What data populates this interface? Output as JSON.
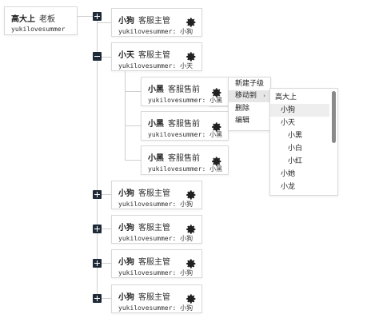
{
  "root": {
    "name": "高大上",
    "role": "老板",
    "account": "yukilovesummer"
  },
  "nodes": [
    {
      "name": "小狗",
      "role": "客服主管",
      "account": "yukilovesummer",
      "owner": "小狗"
    },
    {
      "name": "小天",
      "role": "客服主管",
      "account": "yukilovesummer",
      "owner": "小天"
    },
    {
      "name": "小黑",
      "role": "客服售前",
      "account": "yukilovesummer",
      "owner": "小黑"
    },
    {
      "name": "小黑",
      "role": "客服售前",
      "account": "yukilovesummer",
      "owner": "小黑"
    },
    {
      "name": "小黑",
      "role": "客服售前",
      "account": "yukilovesummer",
      "owner": "小黑"
    },
    {
      "name": "小狗",
      "role": "客服主管",
      "account": "yukilovesummer",
      "owner": "小狗"
    },
    {
      "name": "小狗",
      "role": "客服主管",
      "account": "yukilovesummer",
      "owner": "小狗"
    },
    {
      "name": "小狗",
      "role": "客服主管",
      "account": "yukilovesummer",
      "owner": "小狗"
    },
    {
      "name": "小狗",
      "role": "客服主管",
      "account": "yukilovesummer",
      "owner": "小狗"
    }
  ],
  "context_menu": {
    "items": [
      "新建子级",
      "移动到",
      "删除",
      "编辑"
    ],
    "arrow": "›"
  },
  "move_to_menu": {
    "items": [
      "高大上",
      "小狗",
      "小天",
      "小黑",
      "小白",
      "小红",
      "小她",
      "小龙"
    ]
  },
  "icons": {
    "gear": "gear-icon",
    "expand": "plus-icon",
    "collapse": "minus-icon"
  },
  "colors": {
    "toggle": "#1f2a38",
    "border": "#d9d9d9",
    "highlight": "#e6e6e6"
  }
}
